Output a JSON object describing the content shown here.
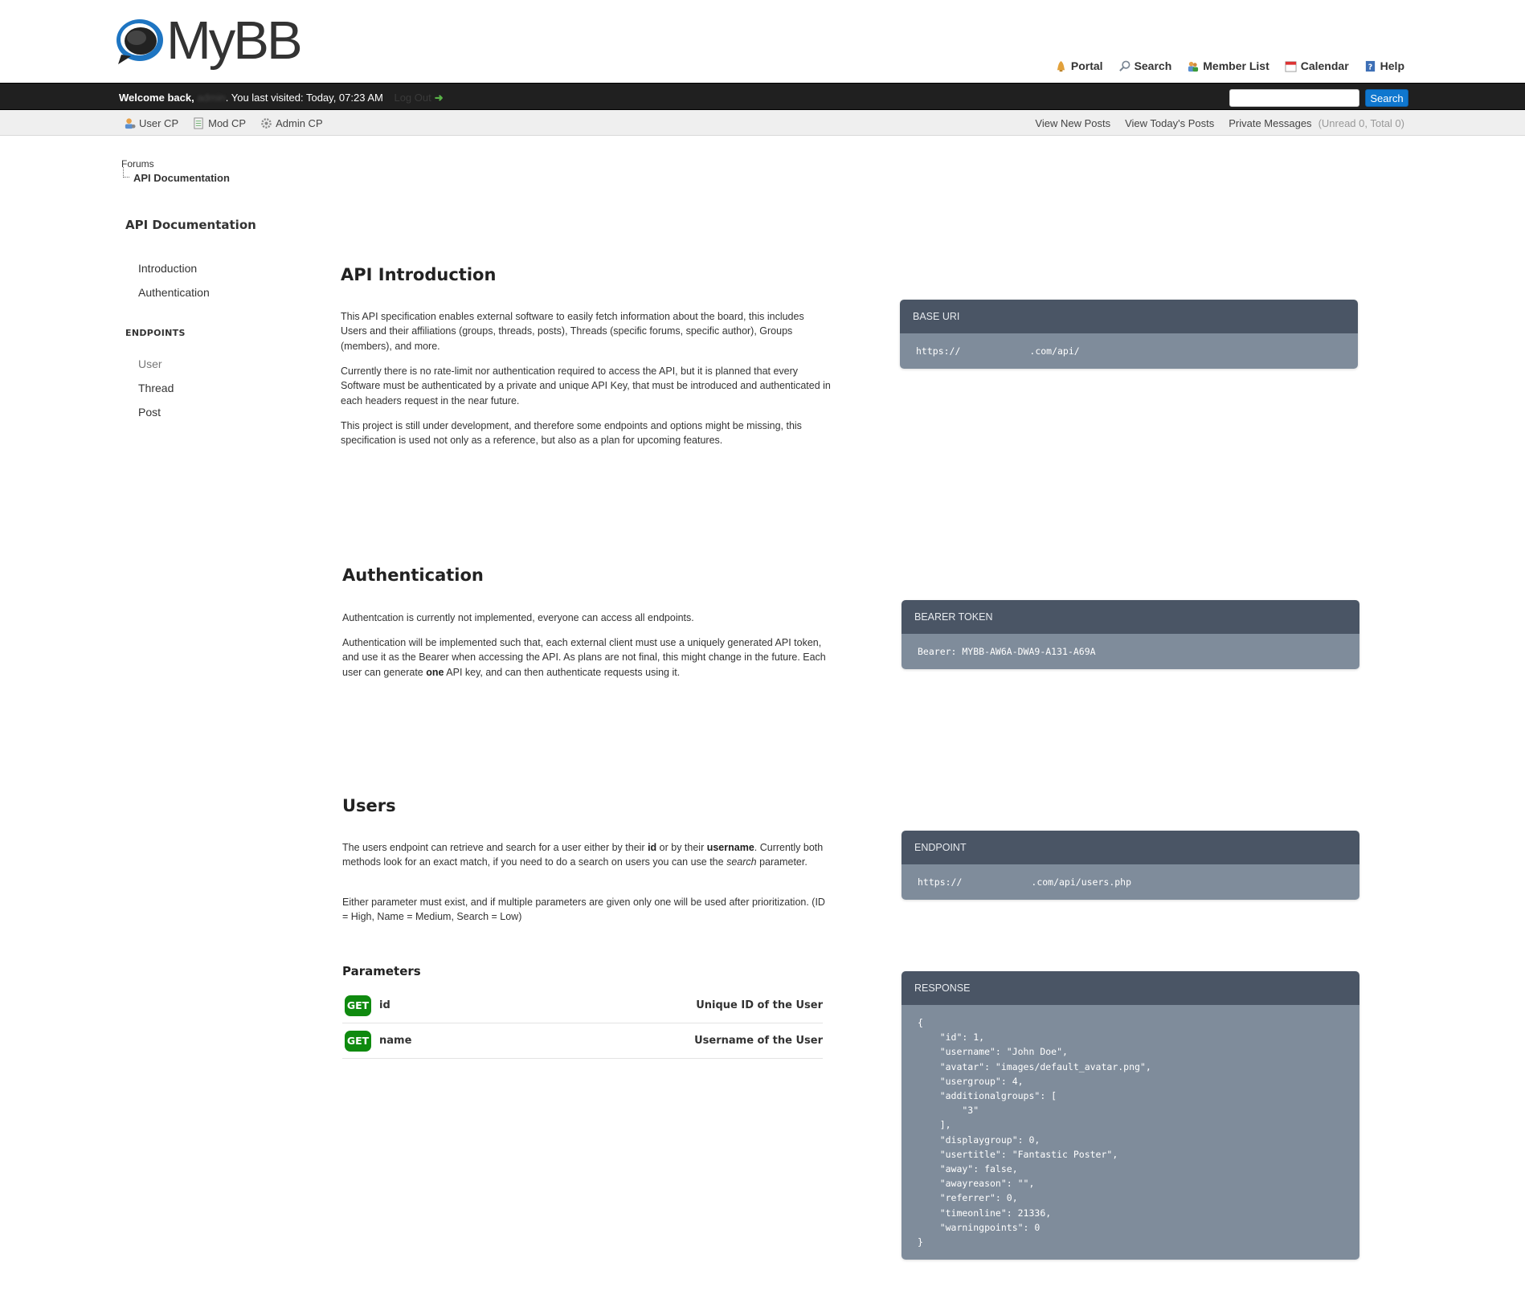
{
  "header": {
    "logo_text": "MyBB",
    "toplinks": [
      {
        "label": "Portal",
        "icon": "portal-icon"
      },
      {
        "label": "Search",
        "icon": "search-icon"
      },
      {
        "label": "Member List",
        "icon": "member-list-icon"
      },
      {
        "label": "Calendar",
        "icon": "calendar-icon"
      },
      {
        "label": "Help",
        "icon": "help-icon"
      }
    ]
  },
  "welcome": {
    "prefix": "Welcome back,",
    "username": "admin",
    "last_visit": ". You last visited: Today, 07:23 AM",
    "logout": "Log Out",
    "logout_arrow": "➜"
  },
  "search": {
    "placeholder": "",
    "button": "Search"
  },
  "panel": {
    "left": [
      {
        "label": "User CP",
        "icon": "user-cp-icon"
      },
      {
        "label": "Mod CP",
        "icon": "mod-cp-icon"
      },
      {
        "label": "Admin CP",
        "icon": "admin-cp-icon"
      }
    ],
    "right": {
      "new_posts": "View New Posts",
      "todays_posts": "View Today's Posts",
      "pm": "Private Messages",
      "pm_count": "(Unread 0, Total 0)"
    }
  },
  "breadcrumb": {
    "root": "Forums",
    "current": "API Documentation"
  },
  "sidebar": {
    "title": "API Documentation",
    "links": [
      "Introduction",
      "Authentication"
    ],
    "section": "ENDPOINTS",
    "endpoints": [
      "User",
      "Thread",
      "Post"
    ]
  },
  "intro": {
    "title": "API Introduction",
    "p1": "This API specification enables external software to easily fetch information about the board, this includes Users and their affiliations (groups, threads, posts), Threads (specific forums, specific author), Groups (members), and more.",
    "p2": "Currently there is no rate-limit nor authentication required to access the API, but it is planned that every Software must be authenticated by a private and unique API Key, that must be introduced and authenticated in each headers request in the near future.",
    "p3": "This project is still under development, and therefore some endpoints and options might be missing, this specification is used not only as a reference, but also as a plan for upcoming features.",
    "card_title": "BASE URI",
    "card_url_start": "https://",
    "card_url_end": ".com/api/"
  },
  "auth": {
    "title": "Authentication",
    "p1": "Authentcation is currently not implemented, everyone can access all endpoints.",
    "p2_a": "Authentication will be implemented such that, each external client must use a uniquely generated API token, and use it as the Bearer when accessing the API. As plans are not final, this might change in the future. Each user can generate ",
    "p2_b": "one",
    "p2_c": " API key, and can then authenticate requests using it.",
    "card_title": "BEARER TOKEN",
    "card_body": "Bearer: MYBB-AW6A-DWA9-A131-A69A"
  },
  "users": {
    "title": "Users",
    "p1_a": "The users endpoint can retrieve and search for a user either by their ",
    "p1_id": "id",
    "p1_b": " or by their ",
    "p1_username": "username",
    "p1_c": ". Currently both methods look for an exact match, if you need to do a search on users you can use the ",
    "p1_search": "search",
    "p1_d": " parameter.",
    "p2": "Either parameter must exist, and if multiple parameters are given only one will be used after prioritization. (ID = High, Name = Medium, Search = Low)",
    "endpoint_title": "ENDPOINT",
    "endpoint_url_start": "https://",
    "endpoint_url_end": ".com/api/users.php",
    "params_title": "Parameters",
    "params": [
      {
        "method": "GET",
        "name": "id",
        "desc": "Unique ID of the User"
      },
      {
        "method": "GET",
        "name": "name",
        "desc": "Username of the User"
      }
    ],
    "response_title": "RESPONSE",
    "response_body": "{\n    \"id\": 1,\n    \"username\": \"John Doe\",\n    \"avatar\": \"images/default_avatar.png\",\n    \"usergroup\": 4,\n    \"additionalgroups\": [\n        \"3\"\n    ],\n    \"displaygroup\": 0,\n    \"usertitle\": \"Fantastic Poster\",\n    \"away\": false,\n    \"awayreason\": \"\",\n    \"referrer\": 0,\n    \"timeonline\": 21336,\n    \"warningpoints\": 0\n}"
  },
  "colors": {
    "dark_bar": "#202020",
    "search_button": "#0f77cf",
    "card_header": "#4a5565",
    "card_body": "#7f8c9b",
    "get_badge": "#0f8a0f"
  }
}
